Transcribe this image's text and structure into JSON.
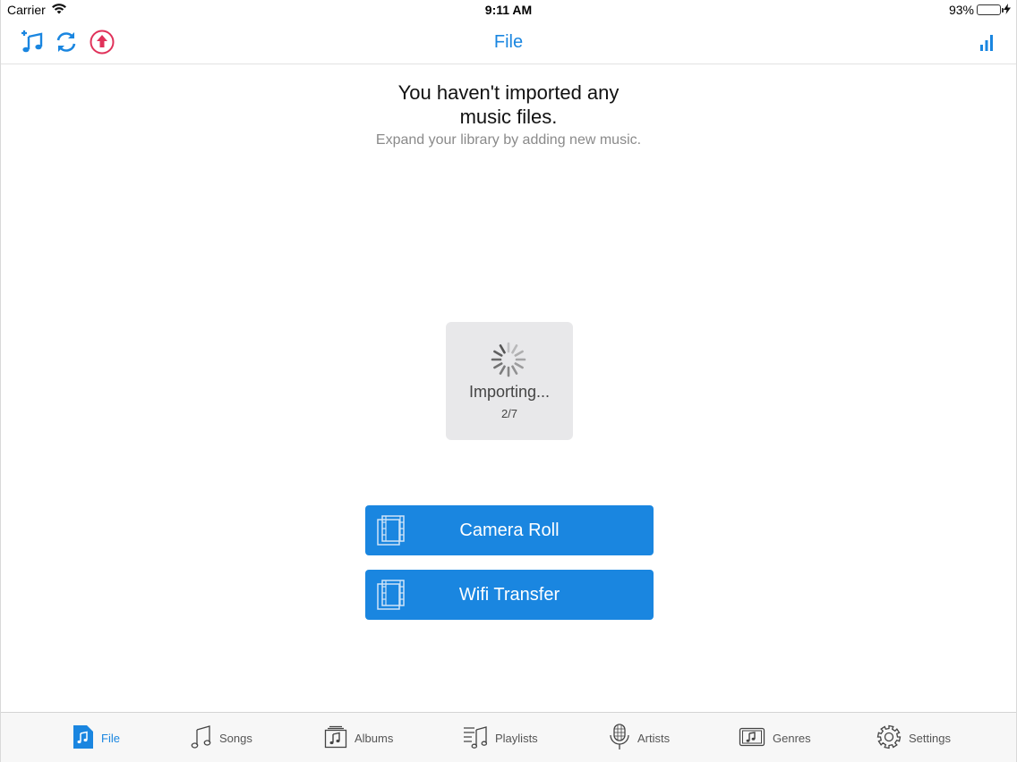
{
  "status_bar": {
    "carrier": "Carrier",
    "time": "9:11 AM",
    "battery": "93%",
    "battery_level": 0.93,
    "wifi_icon": "wifi-icon",
    "charging_icon": "bolt-icon"
  },
  "nav": {
    "title": "File",
    "left_icons": [
      "add-music-icon",
      "refresh-icon",
      "upload-icon"
    ],
    "right_icon": "signal-bars-icon"
  },
  "empty_state": {
    "title_line1": "You haven't imported any",
    "title_line2": "music files.",
    "subtitle": "Expand your library by adding new music."
  },
  "hud": {
    "label": "Importing...",
    "progress": "2/7"
  },
  "actions": [
    {
      "label": "Camera Roll",
      "icon": "film-strip-icon"
    },
    {
      "label": "Wifi Transfer",
      "icon": "film-strip-icon"
    }
  ],
  "tabs": [
    {
      "label": "File",
      "icon": "file-music-icon",
      "active": true
    },
    {
      "label": "Songs",
      "icon": "music-note-icon",
      "active": false
    },
    {
      "label": "Albums",
      "icon": "album-icon",
      "active": false
    },
    {
      "label": "Playlists",
      "icon": "playlist-icon",
      "active": false
    },
    {
      "label": "Artists",
      "icon": "microphone-icon",
      "active": false
    },
    {
      "label": "Genres",
      "icon": "genre-icon",
      "active": false
    },
    {
      "label": "Settings",
      "icon": "gear-icon",
      "active": false
    }
  ],
  "colors": {
    "accent": "#1a86e0",
    "upload_accent": "#e0325a",
    "battery": "#4cd964"
  }
}
